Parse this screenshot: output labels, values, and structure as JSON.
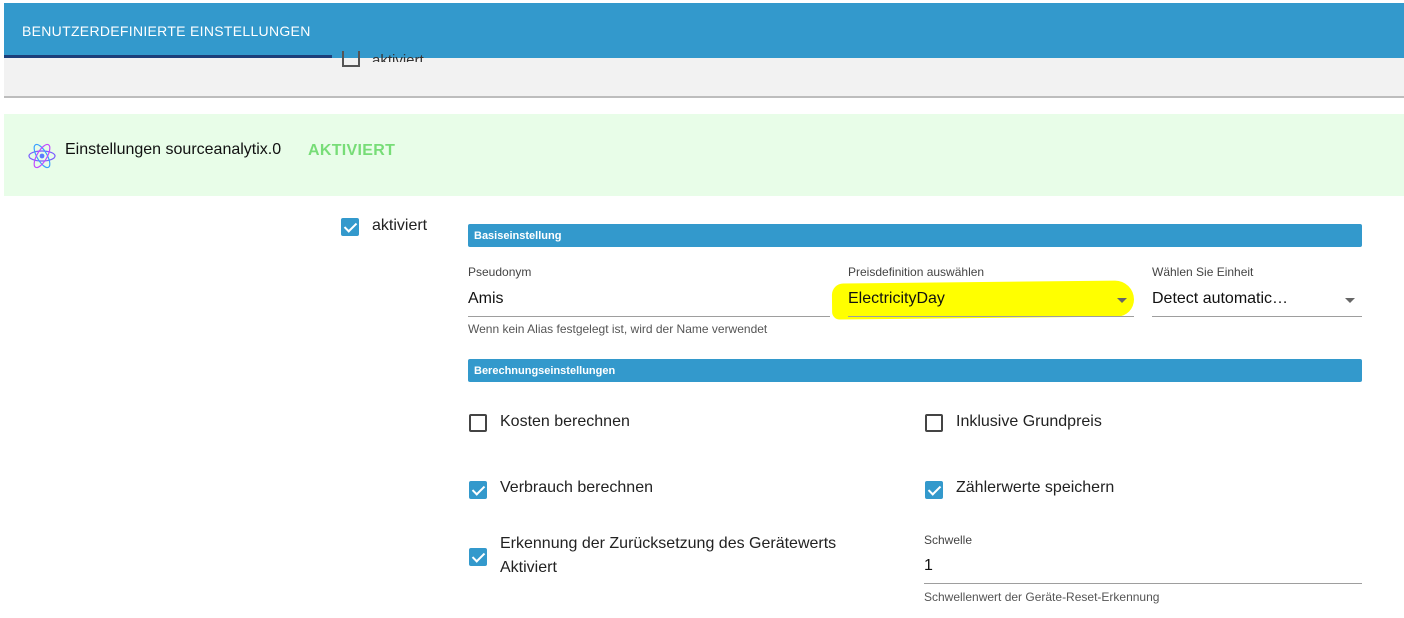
{
  "tabs": [
    {
      "label": "BENUTZERDEFINIERTE EINSTELLUNGEN",
      "active": true
    }
  ],
  "previous_row": {
    "enabled_label": "aktiviert",
    "checked": false
  },
  "adapter": {
    "icon": "atom-icon",
    "title": "Einstellungen sourceanalytix.0",
    "status": "AKTIVIERT",
    "status_color": "#77dd77",
    "header_bg": "#e8fde8"
  },
  "main": {
    "enabled_label": "aktiviert",
    "enabled_checked": true
  },
  "basic_settings": {
    "section_title": "Basiseinstellung",
    "pseudonym": {
      "label": "Pseudonym",
      "value": "Amis",
      "help": "Wenn kein Alias festgelegt ist, wird der Name verwendet"
    },
    "price_definition": {
      "label": "Preisdefinition auswählen",
      "value": "ElectricityDay",
      "highlight_color": "#ffff00"
    },
    "unit": {
      "label": "Wählen Sie Einheit",
      "value": "Detect automatic…"
    }
  },
  "calc_settings": {
    "section_title": "Berechnungseinstellungen",
    "calc_costs": {
      "label": "Kosten berechnen",
      "checked": false
    },
    "incl_base_price": {
      "label": "Inklusive Grundpreis",
      "checked": false
    },
    "calc_consumption": {
      "label": "Verbrauch berechnen",
      "checked": true
    },
    "store_meter_values": {
      "label": "Zählerwerte speichern",
      "checked": true
    },
    "reset_detection": {
      "label_line1": "Erkennung der Zurücksetzung des Gerätewerts",
      "label_line2": "Aktiviert",
      "checked": true
    },
    "threshold": {
      "label": "Schwelle",
      "value": "1",
      "help": "Schwellenwert der Geräte-Reset-Erkennung"
    }
  },
  "colors": {
    "accent": "#3399cc",
    "tab_underline": "#1c3f7a"
  }
}
